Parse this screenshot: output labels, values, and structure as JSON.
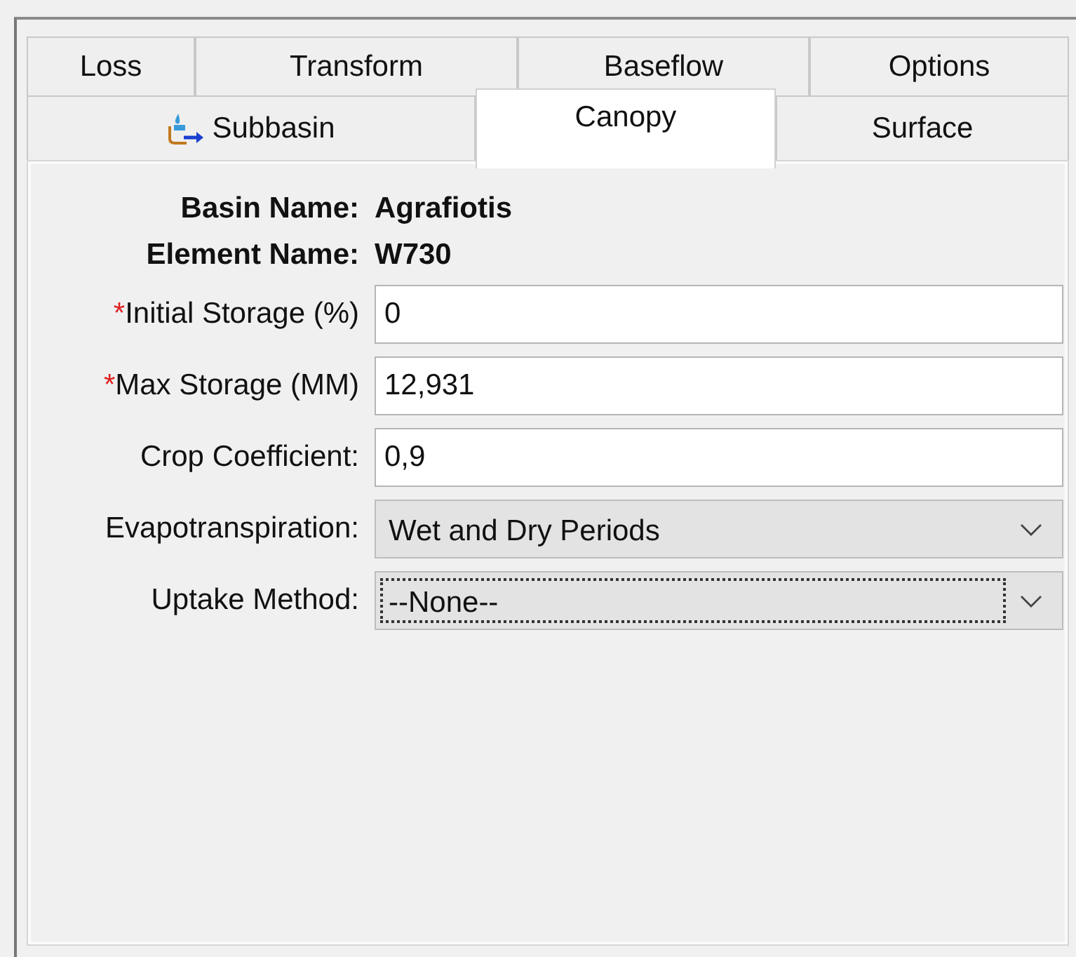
{
  "tab_rows": [
    [
      {
        "kind": "plain",
        "label": "Loss",
        "selected": false
      },
      {
        "kind": "plain",
        "label": "Transform",
        "selected": false
      },
      {
        "kind": "plain",
        "label": "Baseflow",
        "selected": false
      },
      {
        "kind": "plain",
        "label": "Options",
        "selected": false
      }
    ],
    [
      {
        "kind": "element",
        "label": "Subbasin",
        "selected": false
      },
      {
        "kind": "plain",
        "label": "Canopy",
        "selected": true
      },
      {
        "kind": "plain",
        "label": "Surface",
        "selected": false
      }
    ]
  ],
  "info": [
    {
      "label": "Basin Name:",
      "value": "Agrafiotis"
    },
    {
      "label": "Element Name:",
      "value": "W730"
    }
  ],
  "fields": [
    {
      "kind": "text",
      "marker": "*",
      "label": "Initial Storage (%)",
      "value": "0"
    },
    {
      "kind": "text",
      "marker": "*",
      "label": "Max Storage (MM)",
      "value": "12,931"
    },
    {
      "kind": "text",
      "label": "Crop Coefficient:",
      "value": "0,9"
    },
    {
      "kind": "select",
      "label": "Evapotranspiration:",
      "value": "Wet and Dry Periods",
      "focused": false
    },
    {
      "kind": "select",
      "label": "Uptake Method:",
      "value": "--None--",
      "focused": true
    }
  ]
}
